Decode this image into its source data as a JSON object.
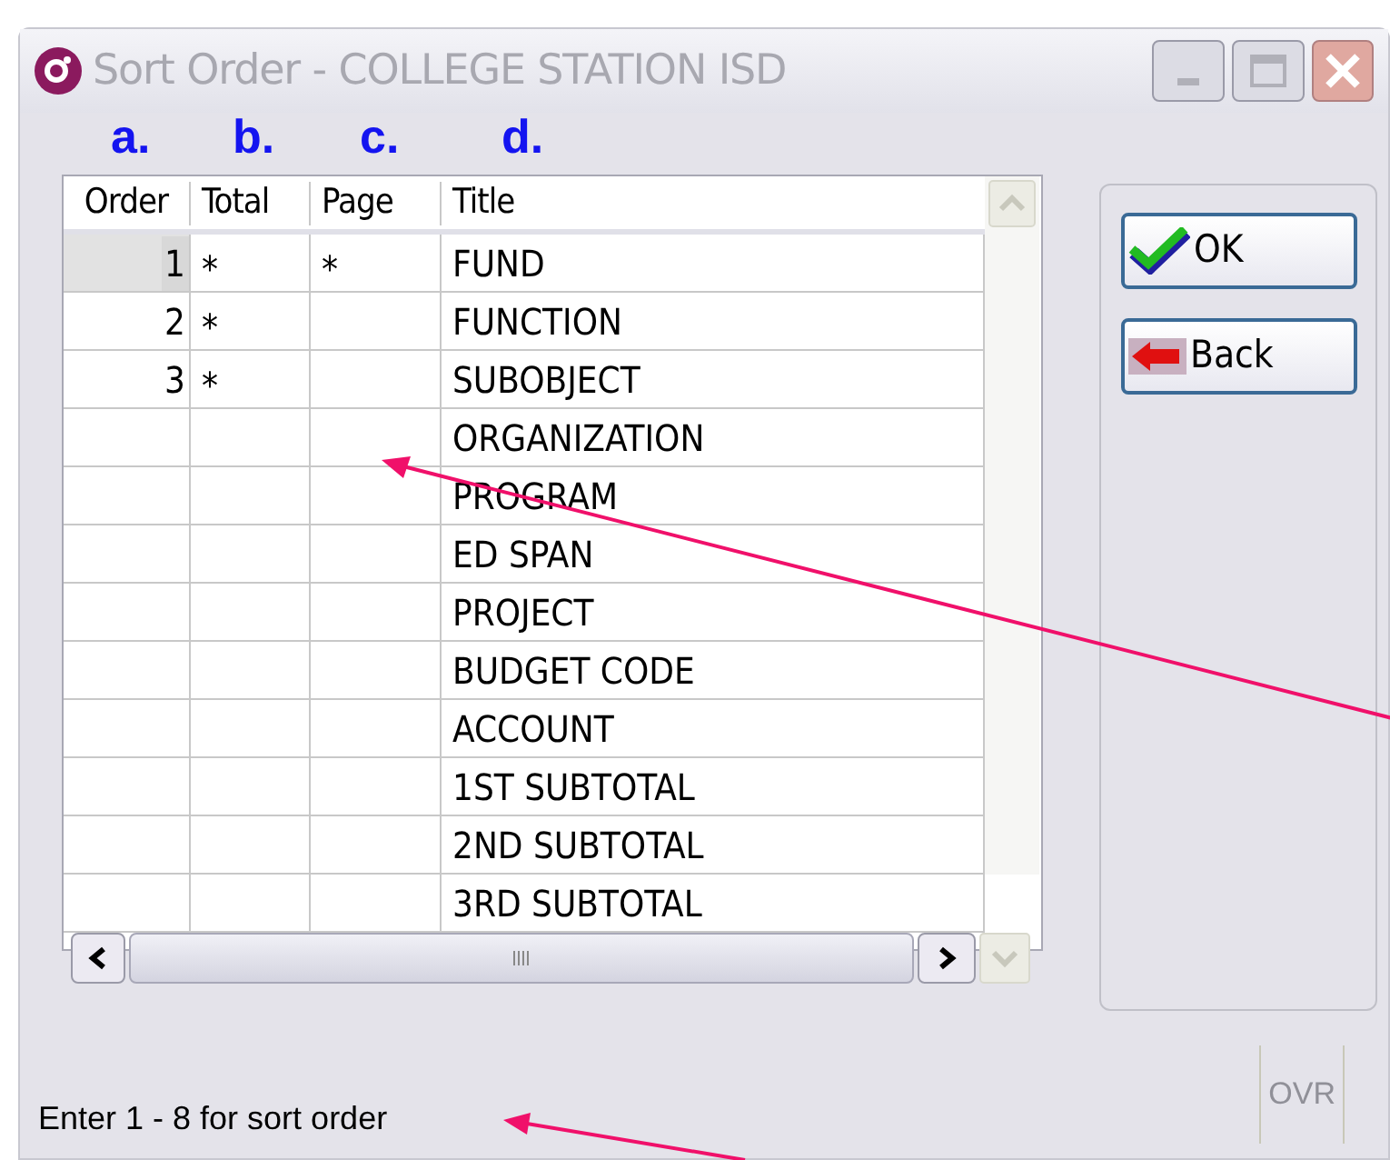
{
  "window": {
    "title": "Sort Order - COLLEGE STATION ISD"
  },
  "annotations": {
    "column_labels": [
      "a.",
      "b.",
      "c.",
      "d."
    ]
  },
  "table": {
    "columns": [
      "Order",
      "Total",
      "Page",
      "Title"
    ],
    "rows": [
      {
        "order": "1",
        "total": "*",
        "page": "*",
        "title": "FUND",
        "selected": true
      },
      {
        "order": "2",
        "total": "*",
        "title": "FUNCTION",
        "selected": false
      },
      {
        "order": "3",
        "total": "*",
        "title": "SUBOBJECT",
        "selected": false
      },
      {
        "title": "ORGANIZATION",
        "selected": false
      },
      {
        "title": "PROGRAM",
        "selected": false
      },
      {
        "title": "ED SPAN",
        "selected": false
      },
      {
        "title": "PROJECT",
        "selected": false
      },
      {
        "title": "BUDGET CODE",
        "selected": false
      },
      {
        "title": "ACCOUNT",
        "selected": false
      },
      {
        "title": "1ST SUBTOTAL",
        "selected": false
      },
      {
        "title": "2ND SUBTOTAL",
        "selected": false
      },
      {
        "title": "3RD SUBTOTAL",
        "selected": false
      }
    ]
  },
  "buttons": [
    {
      "label": "OK",
      "kind": "ok"
    },
    {
      "label": "Back",
      "kind": "back"
    }
  ],
  "status_bar": {
    "message": "Enter 1 - 8 for sort order",
    "mode": "OVR"
  }
}
